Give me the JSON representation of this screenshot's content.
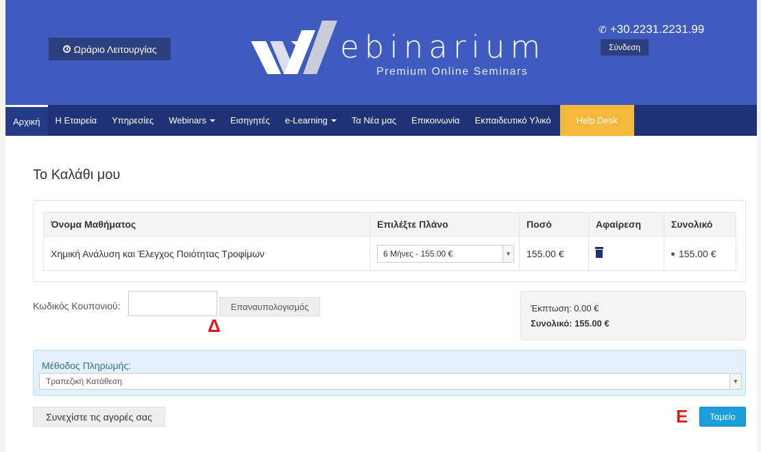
{
  "header": {
    "hours_button": "Ωράριο Λειτουργίας",
    "logo_text": "ebinarium",
    "logo_subtitle": "Premium Online Seminars",
    "phone": "+30.2231.2231.99",
    "login_button": "Σύνδεση",
    "background_color": "#3f5bbf"
  },
  "nav": {
    "items": [
      {
        "label": "Αρχική",
        "active": true
      },
      {
        "label": "Η Εταιρεία"
      },
      {
        "label": "Υπηρεσίες"
      },
      {
        "label": "Webinars",
        "dropdown": true
      },
      {
        "label": "Εισηγητές"
      },
      {
        "label": "e-Learning",
        "dropdown": true
      },
      {
        "label": "Τα Νέα μας"
      },
      {
        "label": "Επικοινωνία"
      },
      {
        "label": "Εκπαιδευτικό Υλικό"
      },
      {
        "label": "Help Desk"
      }
    ],
    "background_color": "#1f3278",
    "helpdesk_color": "#f6b83b"
  },
  "page": {
    "title": "Το Καλάθι μου"
  },
  "cart": {
    "headers": {
      "course_name": "Όνομα Μαθήματος",
      "plan": "Επιλέξτε Πλάνο",
      "amount": "Ποσό",
      "remove": "Αφαίρεση",
      "total": "Συνολικό"
    },
    "rows": [
      {
        "course_name": "Χημική Ανάλυση και Έλεγχος Ποιότητας Τροφίμων",
        "plan": "6 Μήνες - 155.00 €",
        "amount": "155.00 €",
        "total": "155.00 €"
      }
    ]
  },
  "coupon": {
    "label": "Κωδικός Κουπονιού:",
    "value": "",
    "recalculate_button": "Επαναυπολογισμός",
    "marker": "Δ"
  },
  "totals": {
    "discount": "Έκπτωση: 0.00 €",
    "total": "Συνολικό: 155.00 €"
  },
  "payment": {
    "label": "Μέθοδος Πληρωμής:",
    "selected": "Τραπεζική Κατάθεση"
  },
  "actions": {
    "continue_button": "Συνεχίστε τις αγορές σας",
    "marker": "Ε",
    "checkout_button": "Ταμείο",
    "checkout_color": "#1a9fde"
  }
}
